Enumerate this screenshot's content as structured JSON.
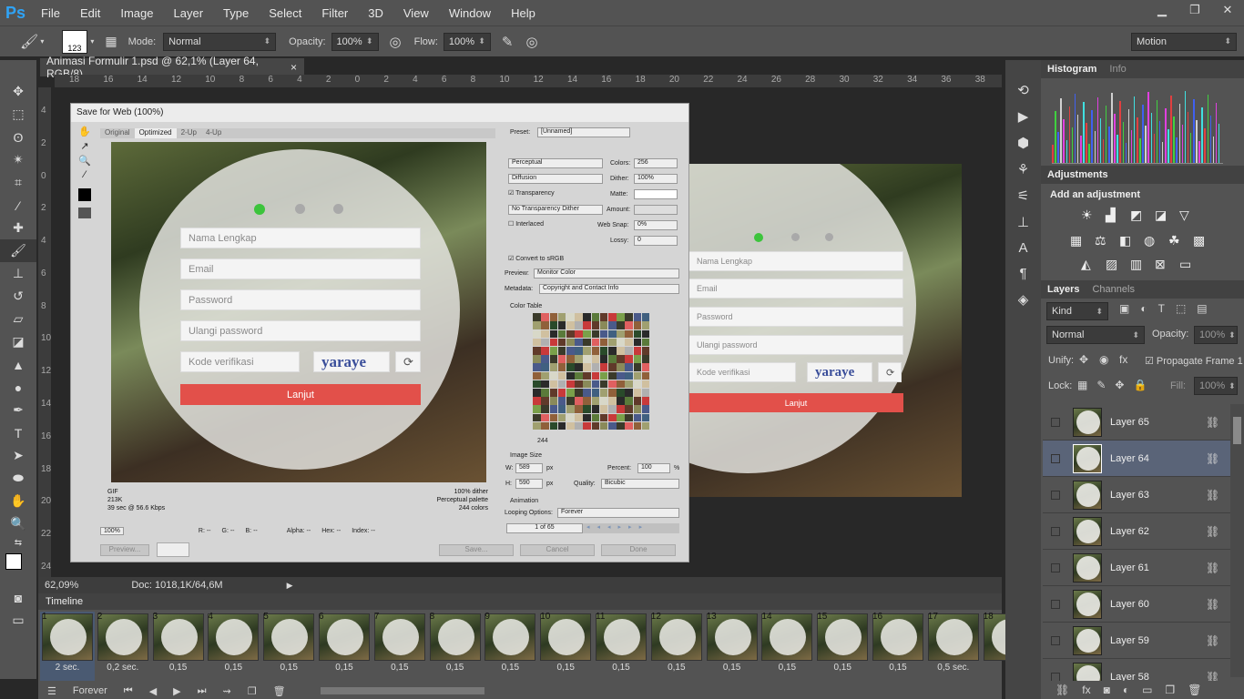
{
  "app": {
    "logo": "Ps",
    "menu": [
      "File",
      "Edit",
      "Image",
      "Layer",
      "Type",
      "Select",
      "Filter",
      "3D",
      "View",
      "Window",
      "Help"
    ],
    "window_controls": [
      "minimize-icon",
      "restore-icon",
      "close-icon"
    ]
  },
  "options": {
    "brush_size": "123",
    "mode_label": "Mode:",
    "mode": "Normal",
    "opacity_label": "Opacity:",
    "opacity": "100%",
    "flow_label": "Flow:",
    "flow": "100%",
    "workspace": "Motion"
  },
  "doc": {
    "tab": "Animasi Formulir 1.psd @ 62,1% (Layer 64, RGB/8)",
    "close": "×",
    "zoom": "62,09%",
    "doc_size": "Doc: 1018,1K/64,6M"
  },
  "ruler_top": [
    "18",
    "16",
    "14",
    "12",
    "10",
    "8",
    "6",
    "4",
    "2",
    "0",
    "2",
    "4",
    "6",
    "8",
    "10",
    "12",
    "14",
    "16",
    "18",
    "20",
    "22",
    "24",
    "26",
    "28",
    "30",
    "32",
    "34",
    "36",
    "38"
  ],
  "ruler_left": [
    "4",
    "2",
    "0",
    "2",
    "4",
    "6",
    "8",
    "10",
    "12",
    "14",
    "16",
    "18",
    "20",
    "22",
    "24"
  ],
  "form": {
    "name": "Nama Lengkap",
    "email": "Email",
    "password": "Password",
    "repeat": "Ulangi password",
    "code": "Kode verifikasi",
    "captcha": "yaraye",
    "submit": "Lanjut"
  },
  "sfw": {
    "title": "Save for Web (100%)",
    "tabs": [
      "Original",
      "Optimized",
      "2-Up",
      "4-Up"
    ],
    "info_left": [
      "GIF",
      "213K",
      "39 sec @ 56.6 Kbps"
    ],
    "info_right": [
      "100% dither",
      "Perceptual palette",
      "244 colors"
    ],
    "zoom": "100%",
    "readouts": [
      "R: --",
      "G: --",
      "B: --",
      "Alpha: --",
      "Hex: --",
      "Index: --"
    ],
    "preset_label": "Preset:",
    "preset": "[Unnamed]",
    "reduction": "Perceptual",
    "dither_algo": "Diffusion",
    "transparency": "Transparency",
    "trans_dither": "No Transparency Dither",
    "interlaced": "Interlaced",
    "colors_label": "Colors:",
    "colors": "256",
    "dither_label": "Dither:",
    "dither": "100%",
    "matte_label": "Matte:",
    "amount_label": "Amount:",
    "websnap_label": "Web Snap:",
    "websnap": "0%",
    "lossy_label": "Lossy:",
    "lossy": "0",
    "convert": "Convert to sRGB",
    "preview_label": "Preview:",
    "preview": "Monitor Color",
    "metadata_label": "Metadata:",
    "metadata": "Copyright and Contact Info",
    "color_table": "Color Table",
    "color_count": "244",
    "image_size": "Image Size",
    "w_label": "W:",
    "w": "589",
    "h_label": "H:",
    "h": "590",
    "px": "px",
    "percent_label": "Percent:",
    "percent": "100",
    "pct": "%",
    "quality_label": "Quality:",
    "quality": "Bicubic",
    "animation": "Animation",
    "looping_label": "Looping Options:",
    "looping": "Forever",
    "frame_of": "1 of 65",
    "btn_preview": "Preview...",
    "btn_save": "Save...",
    "btn_cancel": "Cancel",
    "btn_done": "Done"
  },
  "panels": {
    "histogram": "Histogram",
    "info": "Info",
    "adjustments": "Adjustments",
    "add_adjustment": "Add an adjustment",
    "layers": "Layers",
    "channels": "Channels",
    "kind": "Kind",
    "blend": "Normal",
    "opacity_label": "Opacity:",
    "opacity": "100%",
    "unify": "Unify:",
    "propagate": "Propagate Frame 1",
    "lock": "Lock:",
    "fill_label": "Fill:",
    "fill": "100%"
  },
  "layers": [
    {
      "name": "Layer 65",
      "selected": false
    },
    {
      "name": "Layer 64",
      "selected": true
    },
    {
      "name": "Layer 63",
      "selected": false
    },
    {
      "name": "Layer 62",
      "selected": false
    },
    {
      "name": "Layer 61",
      "selected": false
    },
    {
      "name": "Layer 60",
      "selected": false
    },
    {
      "name": "Layer 59",
      "selected": false
    },
    {
      "name": "Layer 58",
      "selected": false
    }
  ],
  "timeline": {
    "title": "Timeline",
    "loop": "Forever",
    "frames": [
      {
        "n": "1",
        "d": "2 sec."
      },
      {
        "n": "2",
        "d": "0,2 sec."
      },
      {
        "n": "3",
        "d": "0,15"
      },
      {
        "n": "4",
        "d": "0,15"
      },
      {
        "n": "5",
        "d": "0,15"
      },
      {
        "n": "6",
        "d": "0,15"
      },
      {
        "n": "7",
        "d": "0,15"
      },
      {
        "n": "8",
        "d": "0,15"
      },
      {
        "n": "9",
        "d": "0,15"
      },
      {
        "n": "10",
        "d": "0,15"
      },
      {
        "n": "11",
        "d": "0,15"
      },
      {
        "n": "12",
        "d": "0,15"
      },
      {
        "n": "13",
        "d": "0,15"
      },
      {
        "n": "14",
        "d": "0,15"
      },
      {
        "n": "15",
        "d": "0,15"
      },
      {
        "n": "16",
        "d": "0,15"
      },
      {
        "n": "17",
        "d": "0,5 sec."
      },
      {
        "n": "18",
        "d": ""
      }
    ]
  },
  "colors": {
    "accent_red": "#e2504a",
    "green_dot": "#3cc43c",
    "selected_layer": "#5a6478"
  }
}
